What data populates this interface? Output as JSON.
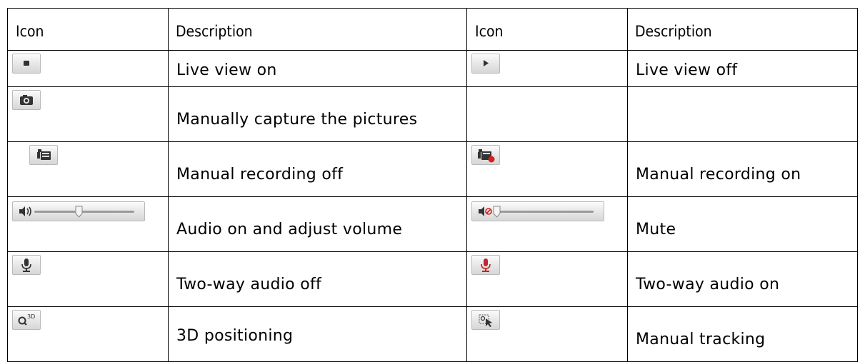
{
  "table": {
    "headers": [
      "Icon",
      "Description",
      "Icon",
      "Description"
    ],
    "rows": [
      {
        "left_icon": "stop-square-icon",
        "left_desc": "Live view on",
        "right_icon": "play-triangle-icon",
        "right_desc": "Live view off"
      },
      {
        "left_icon": "camera-icon",
        "left_desc": "Manually capture the pictures",
        "right_icon": "",
        "right_desc": ""
      },
      {
        "left_icon": "video-camera-icon",
        "left_desc": "Manual recording off",
        "right_icon": "video-camera-recording-icon",
        "right_desc": "Manual recording on"
      },
      {
        "left_icon": "volume-slider-icon",
        "left_desc": "Audio on and adjust volume",
        "right_icon": "mute-slider-icon",
        "right_desc": "Mute"
      },
      {
        "left_icon": "microphone-icon",
        "left_desc": "Two-way audio off",
        "right_icon": "microphone-red-icon",
        "right_desc": "Two-way audio on"
      },
      {
        "left_icon": "magnifier-3d-icon",
        "left_desc": "3D positioning",
        "right_icon": "tracking-cursor-icon",
        "right_desc": "Manual tracking"
      }
    ]
  },
  "icon_labels": {
    "three_d": "3D"
  },
  "colors": {
    "record_red": "#d22020",
    "mic_red": "#c0262a",
    "icon_gray": "#333333"
  }
}
